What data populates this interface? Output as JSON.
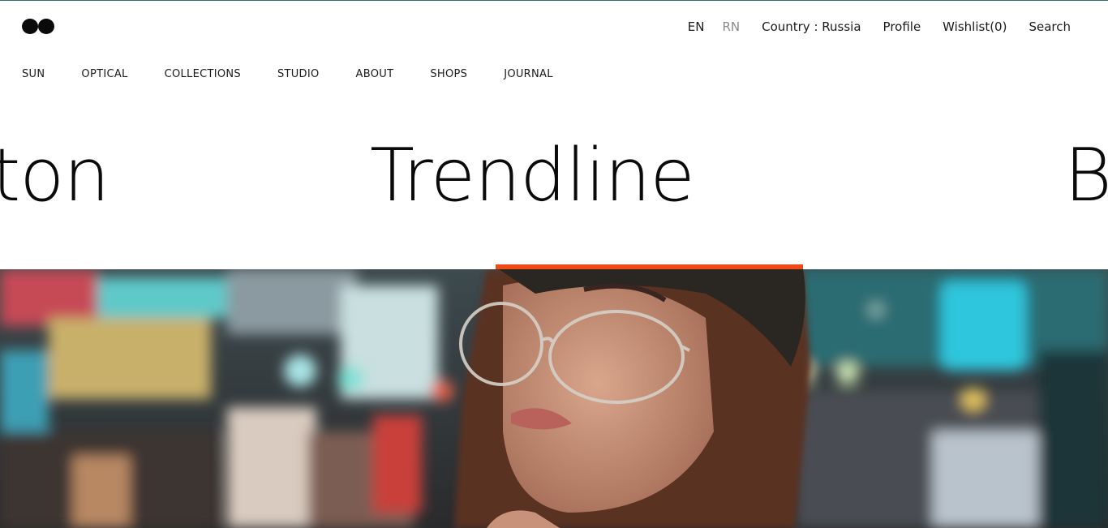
{
  "header": {
    "lang_en": "EN",
    "lang_rn": "RN",
    "country": "Country : Russia",
    "profile": "Profile",
    "wishlist": "Wishlist(0)",
    "search": "Search"
  },
  "nav": {
    "items": [
      "SUN",
      "OPTICAL",
      "COLLECTIONS",
      "STUDIO",
      "ABOUT",
      "SHOPS",
      "JOURNAL"
    ]
  },
  "carousel": {
    "prev": "ton",
    "current": "Trendline",
    "next": "B"
  },
  "colors": {
    "accent": "#f04a17",
    "topline": "#2d6f74",
    "text": "#1a1a1a",
    "muted": "#8a8a8a"
  },
  "hero": {
    "image": "woman-wearing-clear-round-glasses-and-dark-beanie-on-city-street-at-night"
  }
}
